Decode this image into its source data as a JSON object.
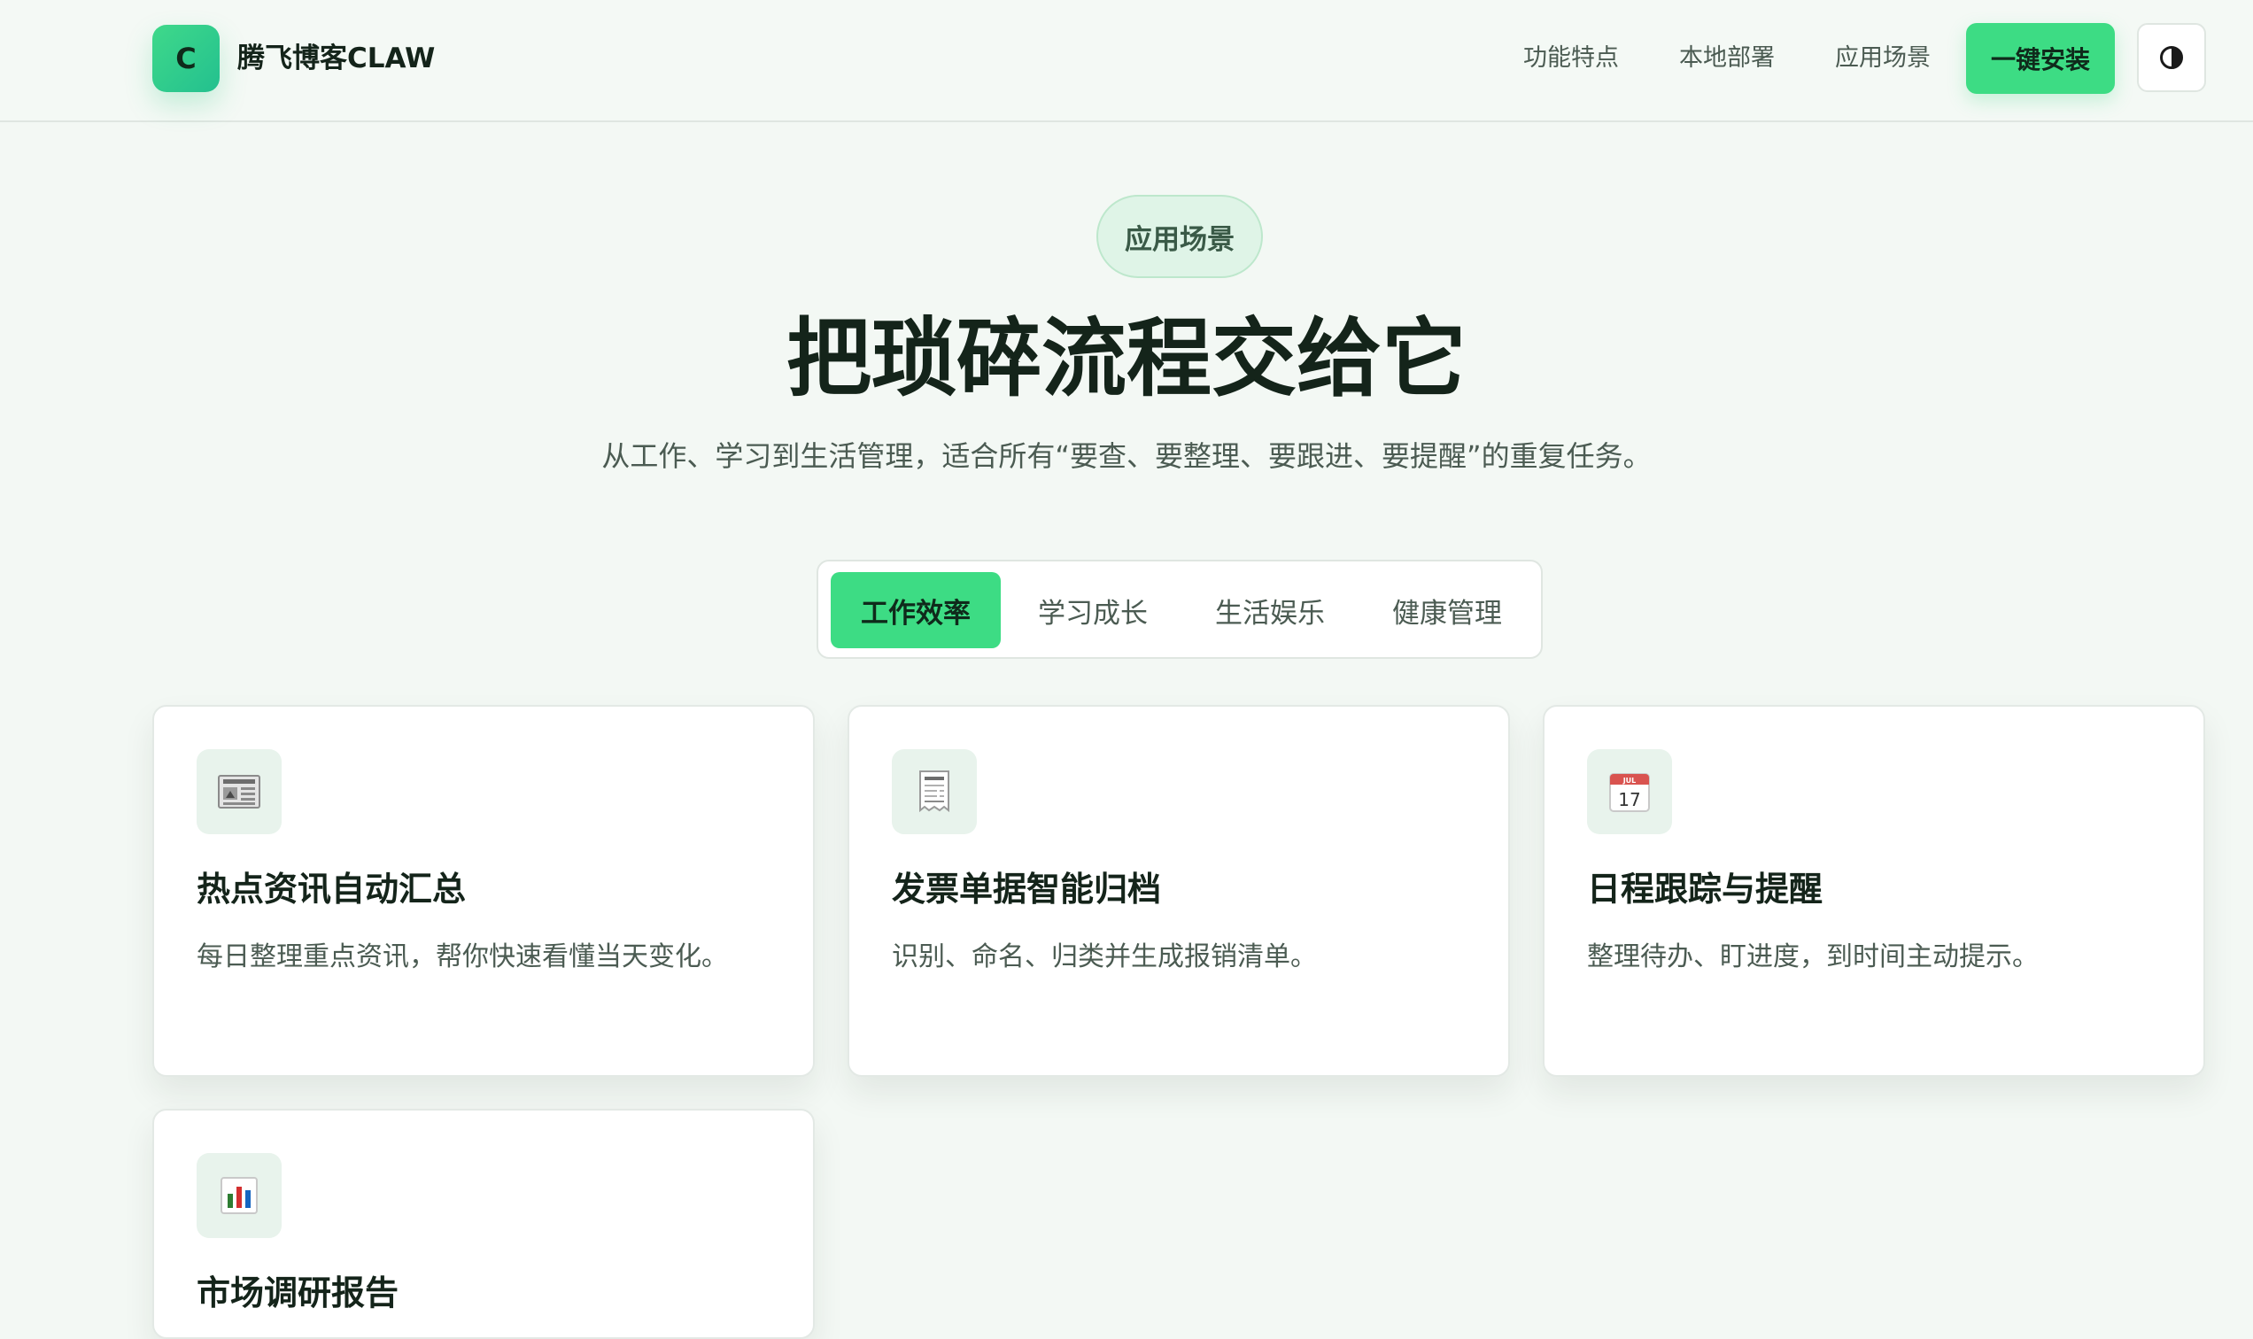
{
  "header": {
    "logo_letter": "C",
    "brand": "腾飞博客CLAW",
    "nav": [
      {
        "label": "功能特点"
      },
      {
        "label": "本地部署"
      },
      {
        "label": "应用场景"
      }
    ],
    "install_label": "一键安装",
    "theme_icon": "contrast-icon"
  },
  "hero": {
    "pill": "应用场景",
    "title": "把琐碎流程交给它",
    "subtitle": "从工作、学习到生活管理，适合所有“要查、要整理、要跟进、要提醒”的重复任务。"
  },
  "tabs": [
    {
      "label": "工作效率",
      "active": true
    },
    {
      "label": "学习成长",
      "active": false
    },
    {
      "label": "生活娱乐",
      "active": false
    },
    {
      "label": "健康管理",
      "active": false
    }
  ],
  "cards": [
    {
      "icon": "newspaper-icon",
      "title": "热点资讯自动汇总",
      "desc": "每日整理重点资讯，帮你快速看懂当天变化。"
    },
    {
      "icon": "receipt-icon",
      "title": "发票单据智能归档",
      "desc": "识别、命名、归类并生成报销清单。"
    },
    {
      "icon": "calendar-icon",
      "title": "日程跟踪与提醒",
      "desc": "整理待办、盯进度，到时间主动提示。",
      "calendar_day": "17",
      "calendar_month": "JUL"
    },
    {
      "icon": "bar-chart-icon",
      "title": "市场调研报告",
      "desc": ""
    }
  ],
  "colors": {
    "accent": "#3ddc84",
    "background": "#f3f8f4",
    "text": "#14241a",
    "muted": "#4b5b52"
  }
}
